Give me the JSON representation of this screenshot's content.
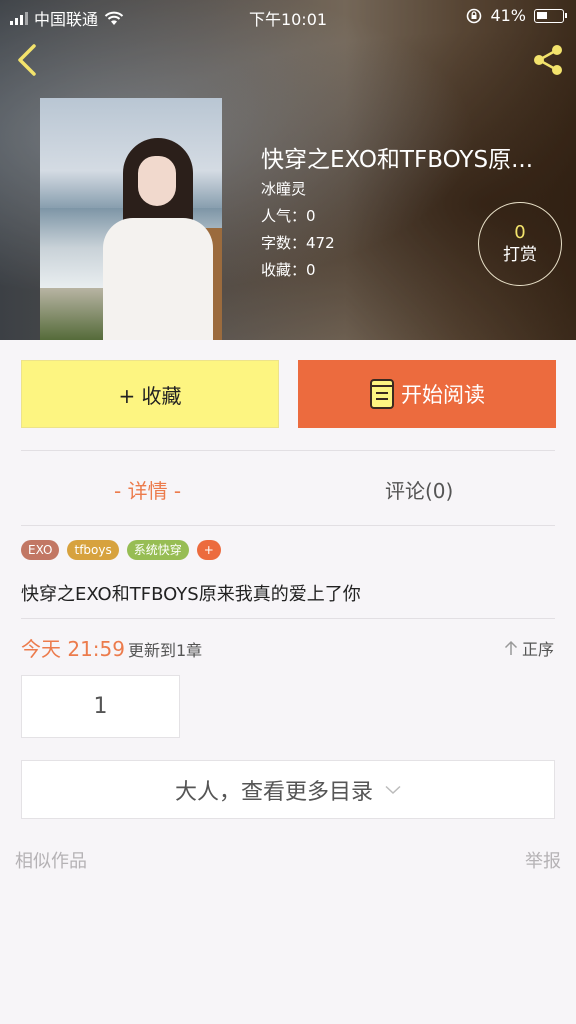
{
  "status_bar": {
    "carrier": "中国联通",
    "time": "下午10:01",
    "battery": "41%"
  },
  "book": {
    "title": "快穿之EXO和TFBOYS原...",
    "author": "冰瞳灵",
    "popularity": "人气：0",
    "word_count": "字数：472",
    "favorites": "收藏：0"
  },
  "reward": {
    "count": "0",
    "label": "打赏"
  },
  "actions": {
    "favorite_label": "+ 收藏",
    "read_label": "开始阅读"
  },
  "tabs": [
    {
      "label": "- 详情 -"
    },
    {
      "label": "评论(0)"
    }
  ],
  "tags": [
    "EXO",
    "tfboys",
    "系统快穿",
    "+"
  ],
  "description": "快穿之EXO和TFBOYS原来我真的爱上了你",
  "update": {
    "time": "今天 21:59",
    "text": "更新到1章",
    "sort_label": "正序"
  },
  "chapters": [
    "1"
  ],
  "more_catalog": "大人，查看更多目录",
  "footer": {
    "similar": "相似作品",
    "report": "举报"
  },
  "colors": {
    "accent": "#ec6b3e",
    "favorite_bg": "#fdf581",
    "reward_num": "#f3e36c"
  }
}
